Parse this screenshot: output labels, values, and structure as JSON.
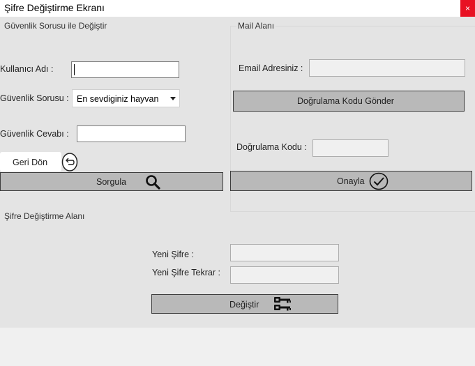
{
  "window": {
    "title": "Şifre Değiştirme Ekranı",
    "close_icon": "close-icon",
    "close_glyph": "×"
  },
  "security_group": {
    "title": "Güvenlik Sorusu ile Değiştir",
    "username_label": "Kullanıcı Adı :",
    "username_value": "",
    "question_label": "Güvenlik Sorusu :",
    "question_selected": "En sevdiginiz hayvan",
    "answer_label": "Güvenlik Cevabı :",
    "answer_value": "",
    "back_label": "Geri Dön",
    "query_label": "Sorgula"
  },
  "mail_group": {
    "title": "Mail Alanı",
    "email_label": "Email Adresiniz :",
    "email_value": "",
    "send_code_label": "Doğrulama Kodu Gönder",
    "code_label": "Doğrulama Kodu :",
    "code_value": "",
    "confirm_label": "Onayla"
  },
  "change_group": {
    "title": "Şifre Değiştirme Alanı",
    "new_password_label": "Yeni Şifre :",
    "new_password_value": "",
    "repeat_password_label": "Yeni Şifre Tekrar :",
    "repeat_password_value": "",
    "change_label": "Değiştir"
  }
}
